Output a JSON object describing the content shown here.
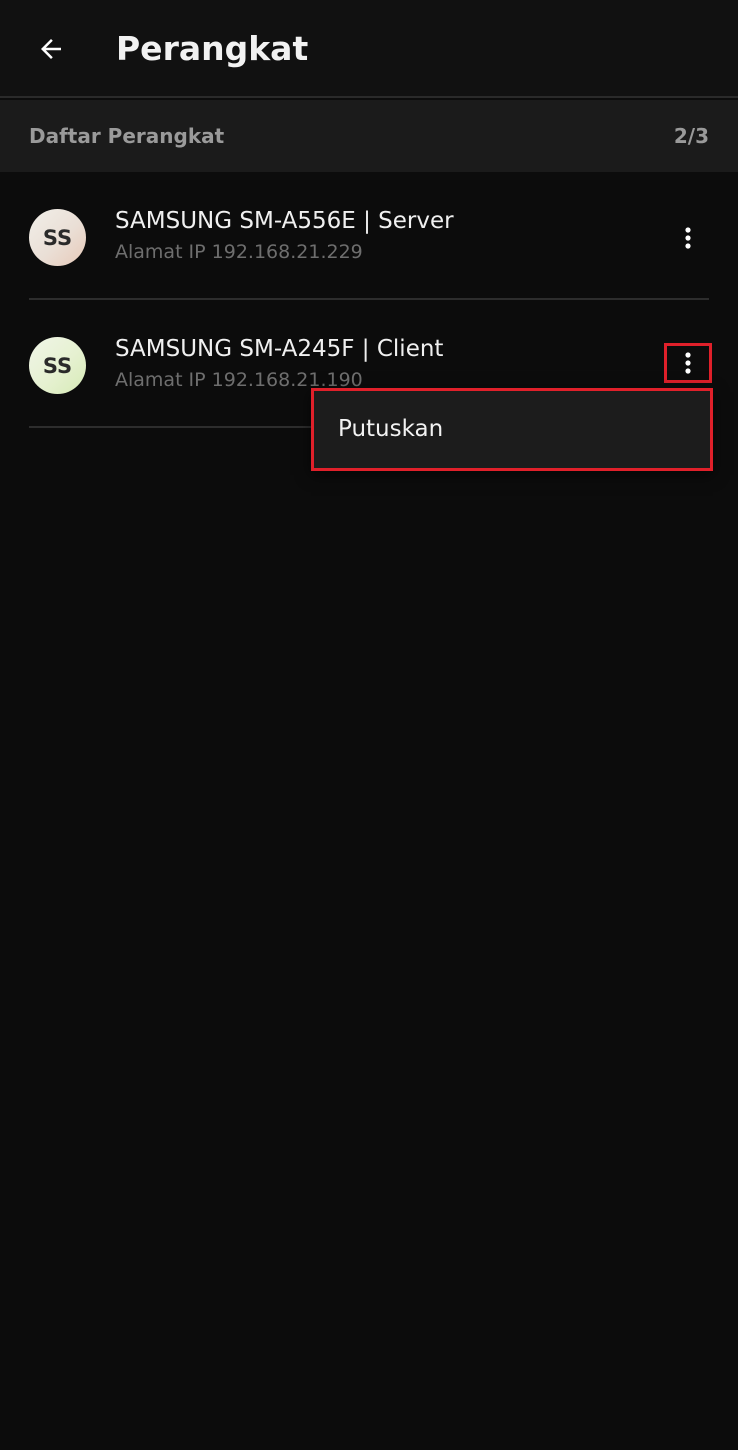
{
  "header": {
    "back_icon": "arrow-left-icon",
    "title": "Perangkat"
  },
  "section": {
    "title": "Daftar Perangkat",
    "count": "2/3"
  },
  "devices": [
    {
      "initials": "SS",
      "name": "SAMSUNG SM-A556E | Server",
      "ip": "Alamat IP 192.168.21.229",
      "menu_icon": "more-vertical-icon"
    },
    {
      "initials": "SS",
      "name": "SAMSUNG SM-A245F | Client",
      "ip": "Alamat IP 192.168.21.190",
      "menu_icon": "more-vertical-icon"
    }
  ],
  "context_menu": {
    "items": [
      "Putuskan"
    ]
  },
  "colors": {
    "background": "#0c0c0c",
    "highlight": "#e0202a"
  }
}
